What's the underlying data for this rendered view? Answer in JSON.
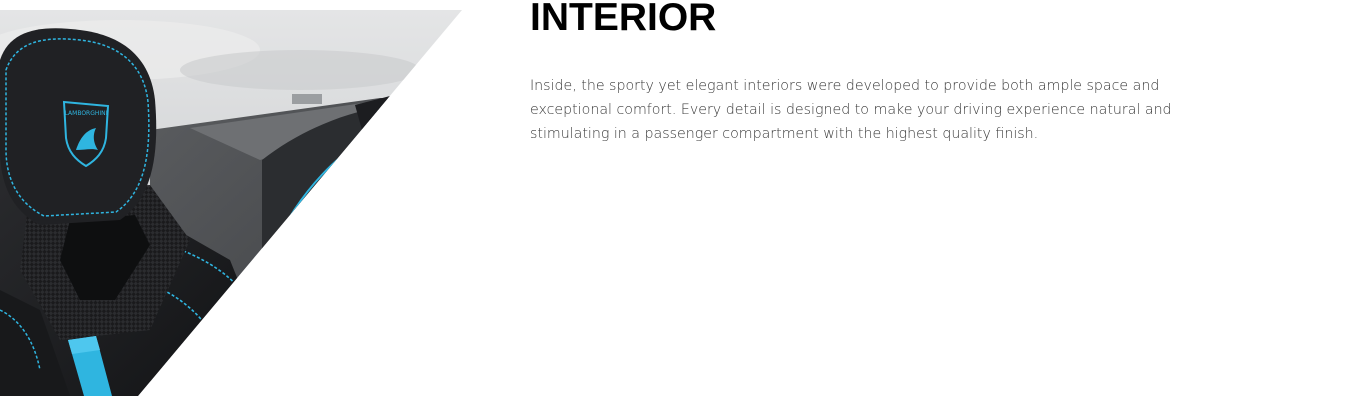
{
  "section": {
    "title": "INTERIOR",
    "body": "Inside, the sporty yet elegant interiors were developed to provide both ample space and exceptional comfort. Every detail is designed to make your driving experience natural and stimulating in a passenger compartment with the highest quality finish."
  },
  "image": {
    "subject": "car-seat-interior-photo",
    "logo_text": "LAMBORGHINI"
  },
  "colors": {
    "background": "#ffffff",
    "title": "#000000",
    "body_text": "#3a3a3a",
    "accent_stitching": "#2fb5e0",
    "seat_alcantara": "#1c1d1f",
    "sky": "#d9dadb"
  }
}
